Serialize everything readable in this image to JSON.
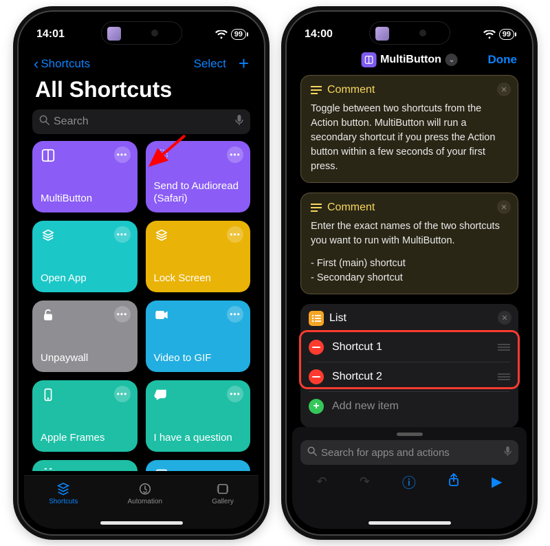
{
  "left": {
    "status_time": "14:01",
    "battery": "99",
    "nav_back": "Shortcuts",
    "nav_select": "Select",
    "title": "All Shortcuts",
    "search_placeholder": "Search",
    "tiles": [
      {
        "name": "MultiButton",
        "color": "#8b5cf6"
      },
      {
        "name": "Send to Audioread (Safari)",
        "color": "#8b5cf6"
      },
      {
        "name": "Open App",
        "color": "#2dd4d4"
      },
      {
        "name": "Lock Screen",
        "color": "#eab308"
      },
      {
        "name": "Unpaywall",
        "color": "#8e8e93"
      },
      {
        "name": "Video to GIF",
        "color": "#22aee0"
      },
      {
        "name": "Apple Frames",
        "color": "#1ebfa5"
      },
      {
        "name": "I have a question",
        "color": "#1ebfa5"
      }
    ],
    "tabs": {
      "shortcuts": "Shortcuts",
      "automation": "Automation",
      "gallery": "Gallery"
    }
  },
  "right": {
    "status_time": "14:00",
    "battery": "99",
    "title": "MultiButton",
    "done": "Done",
    "comment_label": "Comment",
    "comment1_body": "Toggle between two shortcuts from the Action button. MultiButton will run a secondary shortcut if you press the Action button within a few seconds of your first press.",
    "comment2_body_l1": "Enter the exact names of the two shortcuts you want to run with MultiButton.",
    "comment2_body_l2": "- First (main) shortcut",
    "comment2_body_l3": "- Secondary shortcut",
    "list_label": "List",
    "list_items": [
      "Shortcut 1",
      "Shortcut 2"
    ],
    "add_new": "Add new item",
    "sheet_search_placeholder": "Search for apps and actions"
  }
}
